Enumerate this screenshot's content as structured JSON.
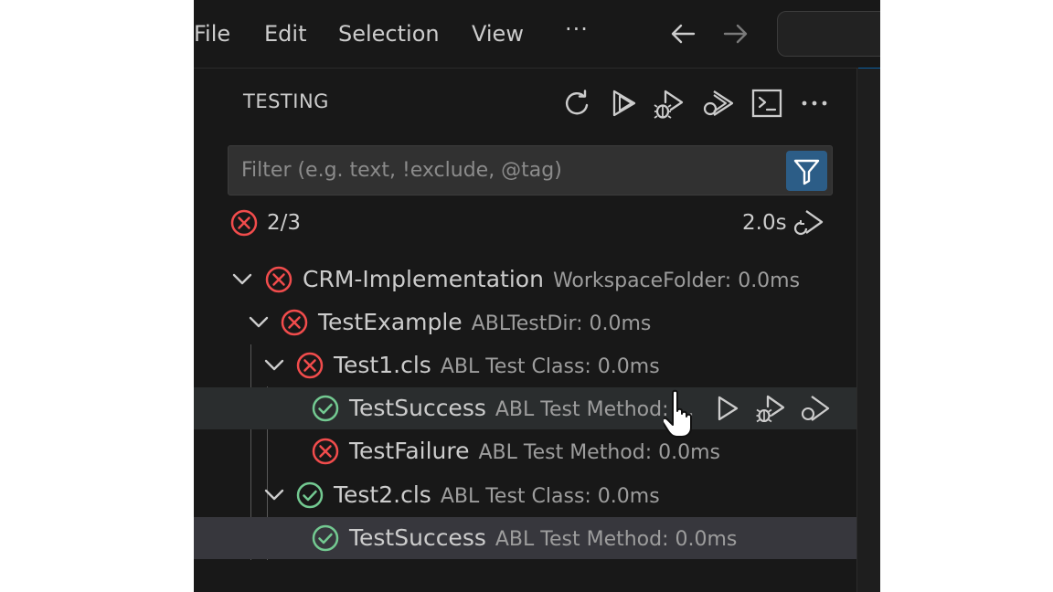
{
  "menubar": {
    "items": [
      "File",
      "Edit",
      "Selection",
      "View"
    ],
    "more_label": "···",
    "back_icon": "arrow-left-icon",
    "forward_icon": "arrow-right-icon"
  },
  "testing": {
    "title": "TESTING",
    "toolbar": [
      "refresh-icon",
      "run-all-icon",
      "debug-all-icon",
      "run-with-coverage-icon",
      "terminal-icon",
      "more-icon"
    ],
    "more_label": "···",
    "filter_placeholder": "Filter (e.g. text, !exclude, @tag)",
    "summary": {
      "count": "2/3",
      "duration": "2.0s"
    },
    "tree": [
      {
        "label": "CRM-Implementation",
        "desc": "WorkspaceFolder: 0.0ms",
        "status": "failed"
      },
      {
        "label": "TestExample",
        "desc": "ABLTestDir: 0.0ms",
        "status": "failed"
      },
      {
        "label": "Test1.cls",
        "desc": "ABL Test Class: 0.0ms",
        "status": "failed"
      },
      {
        "label": "TestSuccess",
        "desc": "ABL Test Method: ...",
        "status": "passed"
      },
      {
        "label": "TestFailure",
        "desc": "ABL Test Method: 0.0ms",
        "status": "failed"
      },
      {
        "label": "Test2.cls",
        "desc": "ABL Test Class: 0.0ms",
        "status": "passed"
      },
      {
        "label": "TestSuccess",
        "desc": "ABL Test Method: 0.0ms",
        "status": "passed"
      }
    ]
  },
  "colors": {
    "failed": "#f14c4c",
    "passed": "#73c991",
    "accent": "#0078d4"
  }
}
